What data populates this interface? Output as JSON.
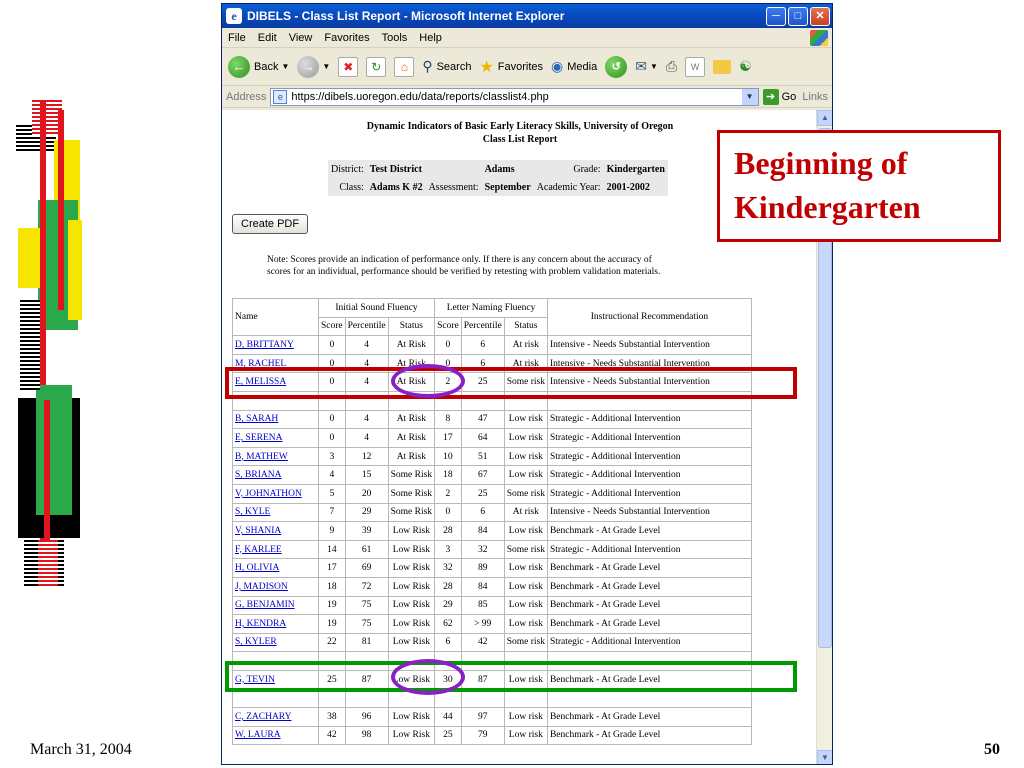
{
  "slide": {
    "date": "March 31, 2004",
    "page_number": "50",
    "callout_line1": "Beginning of",
    "callout_line2": "Kindergarten"
  },
  "window": {
    "title": "DIBELS - Class List Report - Microsoft Internet Explorer",
    "menu": [
      "File",
      "Edit",
      "View",
      "Favorites",
      "Tools",
      "Help"
    ],
    "toolbar": {
      "back_label": "Back",
      "search_label": "Search",
      "favorites_label": "Favorites",
      "media_label": "Media"
    },
    "address_label": "Address",
    "url": "https://dibels.uoregon.edu/data/reports/classlist4.php",
    "go_label": "Go",
    "links_label": "Links"
  },
  "report": {
    "title_line1": "Dynamic Indicators of Basic Early Literacy Skills, University of Oregon",
    "title_line2": "Class List Report",
    "district_label": "District:",
    "district_value": "Test District",
    "school_value": "Adams",
    "grade_label": "Grade:",
    "grade_value": "Kindergarten",
    "class_label": "Class:",
    "class_value": "Adams K #2",
    "assessment_label": "Assessment:",
    "assessment_value": "September",
    "year_label": "Academic Year:",
    "year_value": "2001-2002",
    "pdf_button": "Create PDF",
    "note_line1": "Note: Scores provide an indication of performance only. If there is any concern about the accuracy of",
    "note_line2": "scores for an individual, performance should be verified by retesting with problem validation materials."
  },
  "table": {
    "headers": {
      "name": "Name",
      "isf": "Initial Sound Fluency",
      "lnf": "Letter Naming Fluency",
      "rec": "Instructional Recommendation",
      "score": "Score",
      "percentile": "Percentile",
      "status": "Status"
    },
    "rows": [
      {
        "name": "D, BRITTANY",
        "isf_score": "0",
        "isf_pct": "4",
        "isf_status": "At Risk",
        "lnf_score": "0",
        "lnf_pct": "6",
        "lnf_status": "At risk",
        "rec": "Intensive - Needs Substantial Intervention"
      },
      {
        "name": "M, RACHEL",
        "isf_score": "0",
        "isf_pct": "4",
        "isf_status": "At Risk",
        "lnf_score": "0",
        "lnf_pct": "6",
        "lnf_status": "At risk",
        "rec": "Intensive - Needs Substantial Intervention"
      },
      {
        "name": "E, MELISSA",
        "isf_score": "0",
        "isf_pct": "4",
        "isf_status": "At Risk",
        "lnf_score": "2",
        "lnf_pct": "25",
        "lnf_status": "Some risk",
        "rec": "Intensive - Needs Substantial Intervention"
      },
      {
        "name": "",
        "isf_score": "",
        "isf_pct": "",
        "isf_status": "",
        "lnf_score": "",
        "lnf_pct": "",
        "lnf_status": "",
        "rec": ""
      },
      {
        "name": "B, SARAH",
        "isf_score": "0",
        "isf_pct": "4",
        "isf_status": "At Risk",
        "lnf_score": "8",
        "lnf_pct": "47",
        "lnf_status": "Low risk",
        "rec": "Strategic - Additional Intervention"
      },
      {
        "name": "E, SERENA",
        "isf_score": "0",
        "isf_pct": "4",
        "isf_status": "At Risk",
        "lnf_score": "17",
        "lnf_pct": "64",
        "lnf_status": "Low risk",
        "rec": "Strategic - Additional Intervention"
      },
      {
        "name": "B, MATHEW",
        "isf_score": "3",
        "isf_pct": "12",
        "isf_status": "At Risk",
        "lnf_score": "10",
        "lnf_pct": "51",
        "lnf_status": "Low risk",
        "rec": "Strategic - Additional Intervention"
      },
      {
        "name": "S, BRIANA",
        "isf_score": "4",
        "isf_pct": "15",
        "isf_status": "Some Risk",
        "lnf_score": "18",
        "lnf_pct": "67",
        "lnf_status": "Low risk",
        "rec": "Strategic - Additional Intervention"
      },
      {
        "name": "V, JOHNATHON",
        "isf_score": "5",
        "isf_pct": "20",
        "isf_status": "Some Risk",
        "lnf_score": "2",
        "lnf_pct": "25",
        "lnf_status": "Some risk",
        "rec": "Strategic - Additional Intervention"
      },
      {
        "name": "S, KYLE",
        "isf_score": "7",
        "isf_pct": "29",
        "isf_status": "Some Risk",
        "lnf_score": "0",
        "lnf_pct": "6",
        "lnf_status": "At risk",
        "rec": "Intensive - Needs Substantial Intervention"
      },
      {
        "name": "V, SHANIA",
        "isf_score": "9",
        "isf_pct": "39",
        "isf_status": "Low Risk",
        "lnf_score": "28",
        "lnf_pct": "84",
        "lnf_status": "Low risk",
        "rec": "Benchmark - At Grade Level"
      },
      {
        "name": "F, KARLEE",
        "isf_score": "14",
        "isf_pct": "61",
        "isf_status": "Low Risk",
        "lnf_score": "3",
        "lnf_pct": "32",
        "lnf_status": "Some risk",
        "rec": "Strategic - Additional Intervention"
      },
      {
        "name": "H, OLIVIA",
        "isf_score": "17",
        "isf_pct": "69",
        "isf_status": "Low Risk",
        "lnf_score": "32",
        "lnf_pct": "89",
        "lnf_status": "Low risk",
        "rec": "Benchmark - At Grade Level"
      },
      {
        "name": "J, MADISON",
        "isf_score": "18",
        "isf_pct": "72",
        "isf_status": "Low Risk",
        "lnf_score": "28",
        "lnf_pct": "84",
        "lnf_status": "Low risk",
        "rec": "Benchmark - At Grade Level"
      },
      {
        "name": "G, BENJAMIN",
        "isf_score": "19",
        "isf_pct": "75",
        "isf_status": "Low Risk",
        "lnf_score": "29",
        "lnf_pct": "85",
        "lnf_status": "Low risk",
        "rec": "Benchmark - At Grade Level"
      },
      {
        "name": "H, KENDRA",
        "isf_score": "19",
        "isf_pct": "75",
        "isf_status": "Low Risk",
        "lnf_score": "62",
        "lnf_pct": "> 99",
        "lnf_status": "Low risk",
        "rec": "Benchmark - At Grade Level"
      },
      {
        "name": "S, KYLER",
        "isf_score": "22",
        "isf_pct": "81",
        "isf_status": "Low Risk",
        "lnf_score": "6",
        "lnf_pct": "42",
        "lnf_status": "Some risk",
        "rec": "Strategic - Additional Intervention"
      },
      {
        "name": "",
        "isf_score": "",
        "isf_pct": "",
        "isf_status": "",
        "lnf_score": "",
        "lnf_pct": "",
        "lnf_status": "",
        "rec": ""
      },
      {
        "name": "G, TEVIN",
        "isf_score": "25",
        "isf_pct": "87",
        "isf_status": "Low Risk",
        "lnf_score": "30",
        "lnf_pct": "87",
        "lnf_status": "Low risk",
        "rec": "Benchmark - At Grade Level"
      },
      {
        "name": "",
        "isf_score": "",
        "isf_pct": "",
        "isf_status": "",
        "lnf_score": "",
        "lnf_pct": "",
        "lnf_status": "",
        "rec": ""
      },
      {
        "name": "C, ZACHARY",
        "isf_score": "38",
        "isf_pct": "96",
        "isf_status": "Low Risk",
        "lnf_score": "44",
        "lnf_pct": "97",
        "lnf_status": "Low risk",
        "rec": "Benchmark - At Grade Level"
      },
      {
        "name": "W, LAURA",
        "isf_score": "42",
        "isf_pct": "98",
        "isf_status": "Low Risk",
        "lnf_score": "25",
        "lnf_pct": "79",
        "lnf_status": "Low risk",
        "rec": "Benchmark - At Grade Level"
      }
    ]
  },
  "colors": {
    "callout_red": "#c00000",
    "highlight_green": "#009900",
    "ellipse_purple": "#8a1fc6",
    "link_blue": "#0000cc"
  }
}
